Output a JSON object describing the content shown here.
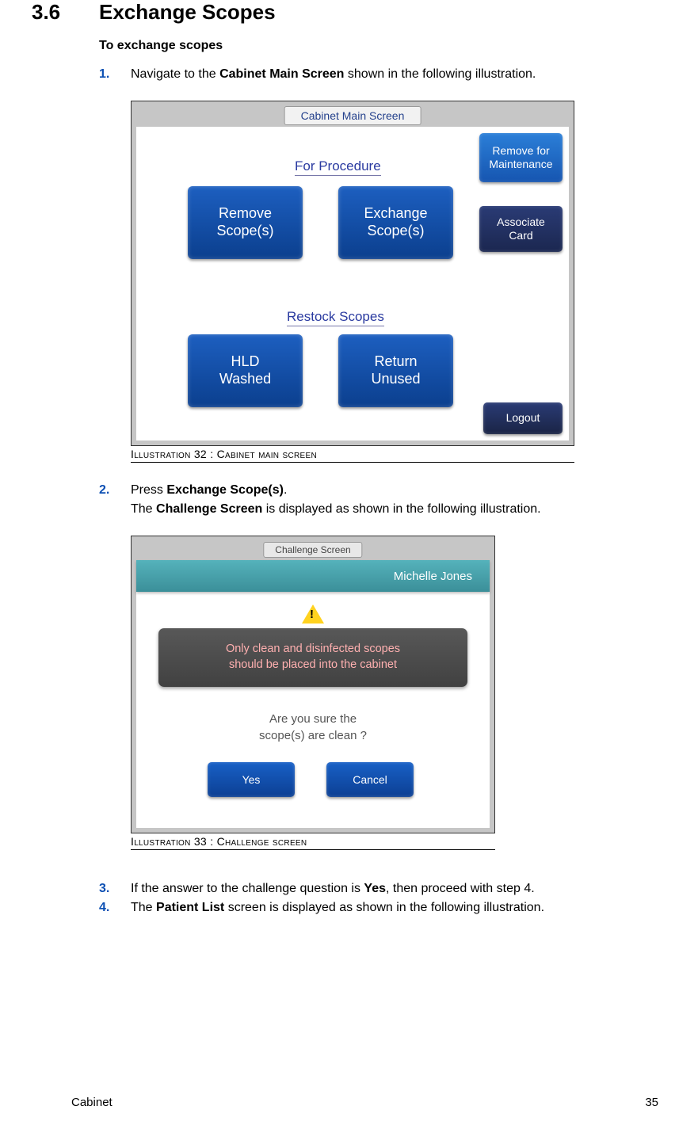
{
  "section": {
    "number": "3.6",
    "title": "Exchange Scopes"
  },
  "subhead": "To exchange scopes",
  "steps": {
    "s1": {
      "num": "1.",
      "pre": "Navigate to the ",
      "bold": "Cabinet Main Screen",
      "post": " shown in the following illustration."
    },
    "s2": {
      "num": "2.",
      "pre": "Press ",
      "bold": "Exchange Scope(s)",
      "post": ".",
      "body_pre": "The ",
      "body_bold": "Challenge Screen",
      "body_post": " is displayed as shown in the following illustration."
    },
    "s3": {
      "num": "3.",
      "pre": "If the answer to the challenge question is ",
      "bold": "Yes",
      "post": ", then proceed with step 4."
    },
    "s4": {
      "num": "4.",
      "pre": "The ",
      "bold": "Patient List",
      "post": " screen is displayed as shown in the following illustration."
    }
  },
  "fig32": {
    "caption": "Illustration 32 : Cabinet main screen",
    "titlebar": "Cabinet Main Screen",
    "for_procedure": "For Procedure",
    "restock": "Restock Scopes",
    "btn_remove_scopes_l1": "Remove",
    "btn_remove_scopes_l2": "Scope(s)",
    "btn_exchange_scopes_l1": "Exchange",
    "btn_exchange_scopes_l2": "Scope(s)",
    "btn_hld_l1": "HLD",
    "btn_hld_l2": "Washed",
    "btn_return_l1": "Return",
    "btn_return_l2": "Unused",
    "side_remove_l1": "Remove for",
    "side_remove_l2": "Maintenance",
    "side_associate_l1": "Associate",
    "side_associate_l2": "Card",
    "side_logout": "Logout"
  },
  "fig33": {
    "caption": "Illustration 33 : Challenge screen",
    "titlebar": "Challenge Screen",
    "user": "Michelle Jones",
    "warn_l1": "Only clean and disinfected scopes",
    "warn_l2": "should be placed into the cabinet",
    "q_l1": "Are you sure the",
    "q_l2": "scope(s) are clean ?",
    "btn_yes": "Yes",
    "btn_cancel": "Cancel"
  },
  "footer": {
    "left": "Cabinet",
    "right": "35"
  }
}
